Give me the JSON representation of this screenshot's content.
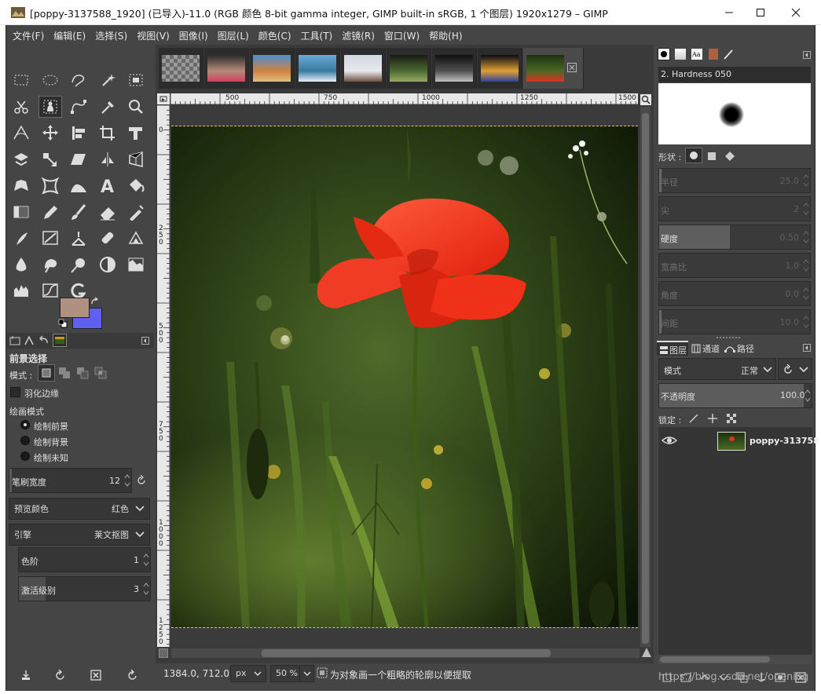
{
  "window": {
    "title": "[poppy-3137588_1920] (已导入)-11.0 (RGB 颜色 8-bit gamma integer, GIMP built-in sRGB, 1 个图层) 1920x1279 – GIMP",
    "controls": [
      "minimize",
      "maximize",
      "close"
    ]
  },
  "menu": [
    "文件(F)",
    "编辑(E)",
    "选择(S)",
    "视图(V)",
    "图像(I)",
    "图层(L)",
    "颜色(C)",
    "工具(T)",
    "滤镜(R)",
    "窗口(W)",
    "帮助(H)"
  ],
  "toolbox": {
    "tools": [
      "rect-select-icon",
      "ellipse-select-icon",
      "free-select-icon",
      "fuzzy-select-icon",
      "select-by-color-icon",
      "scissors-select-icon",
      "foreground-select-icon",
      "paths-icon",
      "color-picker-icon",
      "zoom-icon",
      "measure-icon",
      "move-icon",
      "align-icon",
      "crop-icon",
      "unified-transform-icon",
      "rotate-icon",
      "scale-icon",
      "shear-icon",
      "flip-icon",
      "perspective-icon",
      "warp-transform-icon",
      "cage-transform-icon",
      "handle-transform-icon",
      "text-icon",
      "bucket-fill-icon",
      "gradient-icon",
      "pencil-icon",
      "paintbrush-icon",
      "eraser-icon",
      "airbrush-icon",
      "ink-icon",
      "mypaint-brush-icon",
      "clone-icon",
      "heal-icon",
      "perspective-clone-icon",
      "blur-icon",
      "smudge-icon",
      "dodge-burn-icon",
      "levels-icon",
      "curves-icon",
      "histogram-icon",
      "graph-icon",
      "gegl-icon"
    ],
    "active_tool": "foreground-select-icon",
    "fg_color": "#b09080",
    "bg_color": "#6060f0"
  },
  "tool_options": {
    "title": "前景选择",
    "mode_label": "模式 :",
    "feather_label": "羽化边缘",
    "draw_mode_label": "绘画模式",
    "draw_modes": [
      "绘制前景",
      "绘制背景",
      "绘制未知"
    ],
    "stroke_width": {
      "label": "笔刷宽度",
      "value": "12"
    },
    "preview_color": {
      "label": "预览颜色",
      "value": "红色"
    },
    "engine": {
      "label": "引擎",
      "value": "莱文抠图"
    },
    "levels": {
      "label": "色阶",
      "value": "1"
    },
    "active_levels": {
      "label": "激活级别",
      "value": "3"
    }
  },
  "canvas": {
    "ruler_ticks_h": [
      "500",
      "750",
      "1000",
      "1250",
      "1500"
    ],
    "ruler_ticks_v": [
      "0",
      "250",
      "500",
      "750",
      "1000",
      "1250"
    ],
    "ruler_origin": "0",
    "status": {
      "coords": "1384.0, 712.0",
      "unit": "px",
      "zoom": "50 %",
      "hint": "为对象画一个粗略的轮廓以便提取"
    }
  },
  "brushes": {
    "brush_name": "2. Hardness 050",
    "shape_label": "形状 :",
    "params": [
      {
        "label": "半径",
        "value": "25.0",
        "enabled": false
      },
      {
        "label": "尖",
        "value": "2",
        "enabled": false
      },
      {
        "label": "硬度",
        "value": "0.50",
        "enabled": true
      },
      {
        "label": "宽高比",
        "value": "1.0",
        "enabled": false
      },
      {
        "label": "角度",
        "value": "0.0",
        "enabled": false
      },
      {
        "label": "间距",
        "value": "10.0",
        "enabled": false
      }
    ]
  },
  "layers": {
    "tabs": [
      "图层",
      "通道",
      "路径"
    ],
    "mode_label": "模式",
    "mode_value": "正常",
    "opacity_label": "不透明度",
    "opacity_value": "100.0",
    "lock_label": "锁定 :",
    "layer_name": "poppy-313758"
  },
  "watermark": "https://blog.csdn.net/ooening"
}
